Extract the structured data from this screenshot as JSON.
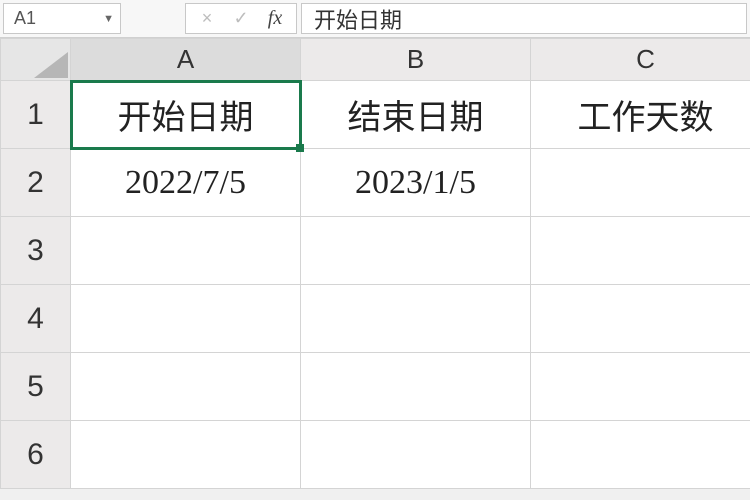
{
  "formula_bar": {
    "cell_ref": "A1",
    "cancel_icon": "×",
    "confirm_icon": "✓",
    "fx_label": "fx",
    "formula_value": "开始日期"
  },
  "columns": [
    "A",
    "B",
    "C"
  ],
  "row_numbers": [
    "1",
    "2",
    "3",
    "4",
    "5",
    "6"
  ],
  "cells": {
    "A1": "开始日期",
    "B1": "结束日期",
    "C1": "工作天数",
    "A2": "2022/7/5",
    "B2": "2023/1/5",
    "C2": "",
    "A3": "",
    "B3": "",
    "C3": "",
    "A4": "",
    "B4": "",
    "C4": "",
    "A5": "",
    "B5": "",
    "C5": "",
    "A6": "",
    "B6": "",
    "C6": ""
  },
  "selected_cell": "A1"
}
